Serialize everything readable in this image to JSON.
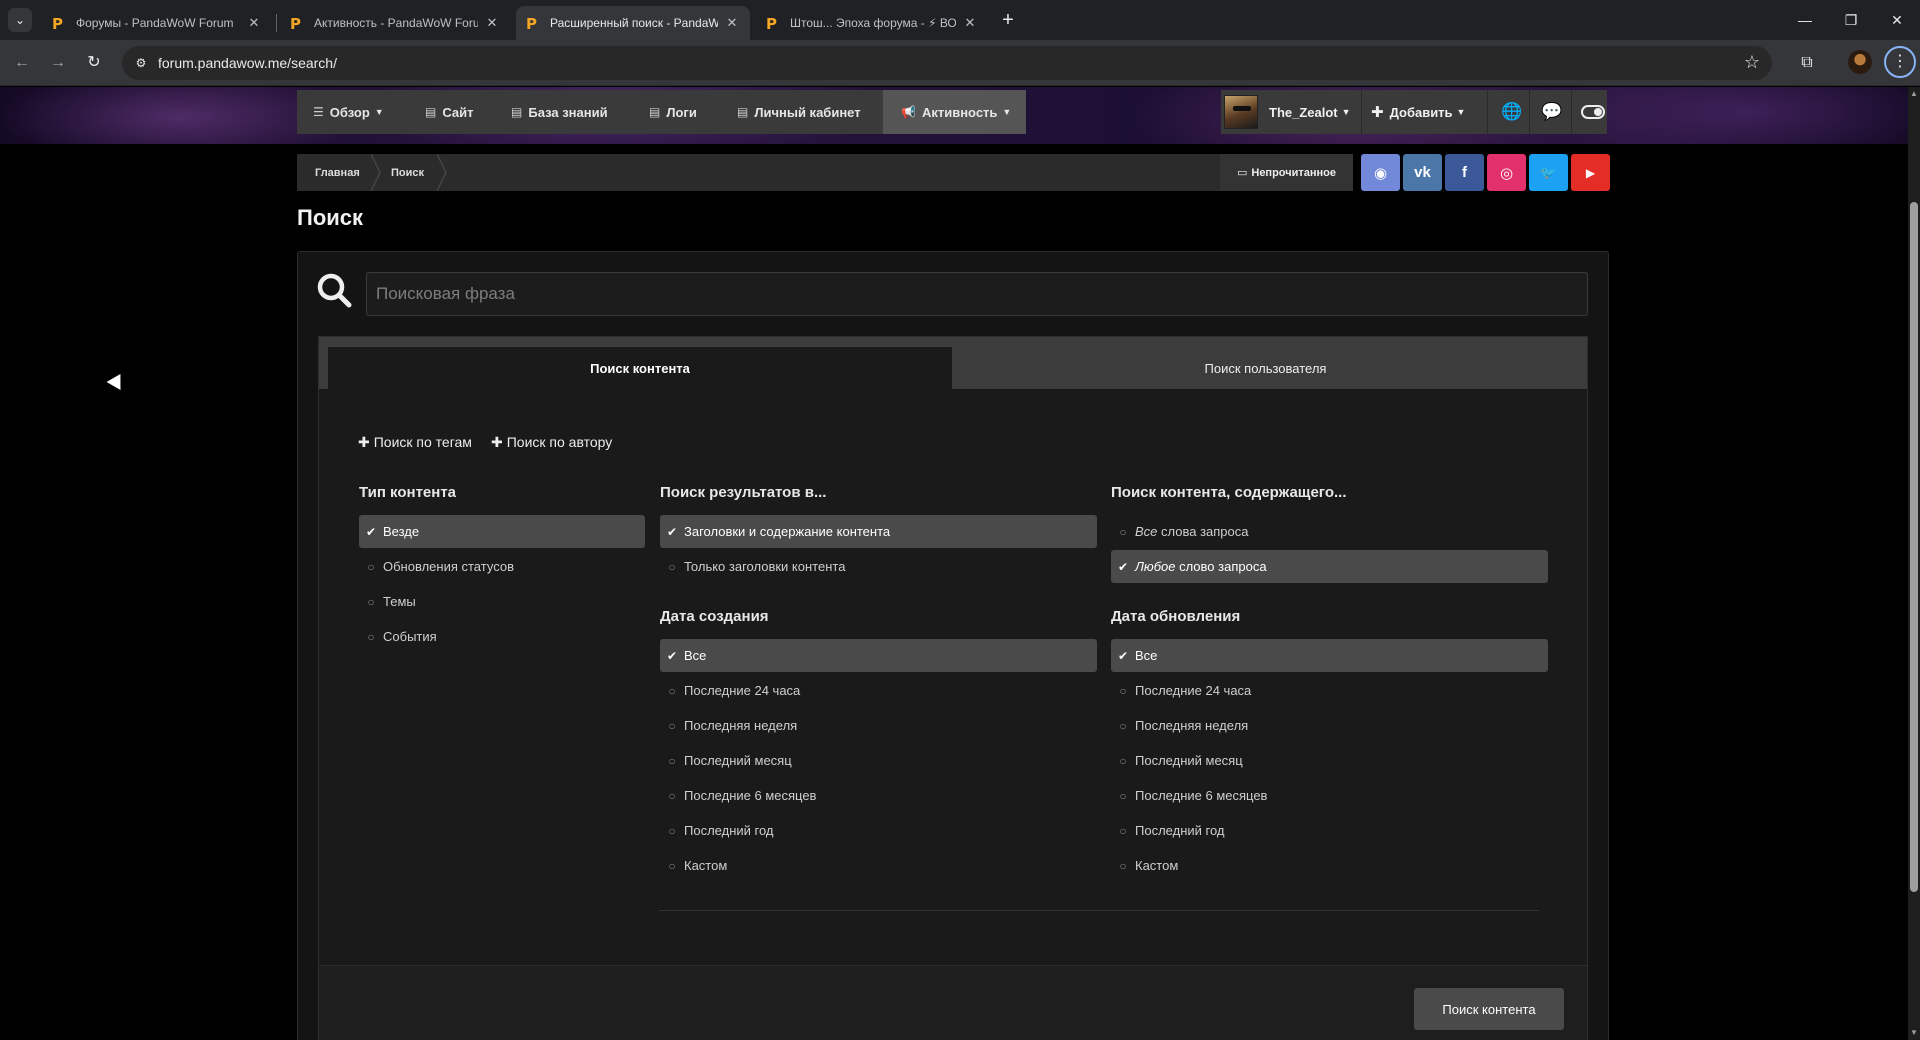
{
  "browser": {
    "tabs": [
      {
        "title": "Форумы - PandaWoW Forum",
        "active": false
      },
      {
        "title": "Активность - PandaWoW Forum",
        "active": false
      },
      {
        "title": "Расширенный поиск - PandaWoW",
        "active": true
      },
      {
        "title": "Штош... Эпоха форума - ⚡ ВО",
        "active": false
      }
    ],
    "url": "forum.pandawow.me/search/"
  },
  "nav": {
    "items": [
      {
        "label": "Обзор",
        "icon": "list-icon",
        "dropdown": true
      },
      {
        "label": "Сайт",
        "icon": "document-icon"
      },
      {
        "label": "База знаний",
        "icon": "document-icon"
      },
      {
        "label": "Логи",
        "icon": "document-icon"
      },
      {
        "label": "Личный кабинет",
        "icon": "document-icon"
      },
      {
        "label": "Активность",
        "icon": "megaphone-icon",
        "dropdown": true,
        "active": true
      }
    ],
    "username": "The_Zealot",
    "add_label": "Добавить"
  },
  "breadcrumb": [
    "Главная",
    "Поиск"
  ],
  "unread_label": "Непрочитанное",
  "social": [
    {
      "name": "discord",
      "color": "#7289da",
      "glyph": "◉"
    },
    {
      "name": "vk",
      "color": "#4a76a8",
      "glyph": "vk"
    },
    {
      "name": "facebook",
      "color": "#3b5998",
      "glyph": "f"
    },
    {
      "name": "instagram",
      "color": "#e1306c",
      "glyph": "◎"
    },
    {
      "name": "twitter",
      "color": "#1da1f2",
      "glyph": "🐦"
    },
    {
      "name": "youtube",
      "color": "#e52d27",
      "glyph": "▶"
    }
  ],
  "page_title": "Поиск",
  "search": {
    "placeholder": "Поисковая фраза",
    "value": ""
  },
  "tabs": [
    "Поиск контента",
    "Поиск пользователя"
  ],
  "filters": [
    "Поиск по тегам",
    "Поиск по автору"
  ],
  "content_type": {
    "title": "Тип контента",
    "options": [
      "Везде",
      "Обновления статусов",
      "Темы",
      "События"
    ],
    "selected": 0
  },
  "search_in": {
    "title": "Поиск результатов в...",
    "options": [
      "Заголовки и содержание контента",
      "Только заголовки контента"
    ],
    "selected": 0
  },
  "match": {
    "title": "Поиск контента, содержащего...",
    "options": [
      {
        "em": "Все",
        "rest": " слова запроса"
      },
      {
        "em": "Любое",
        "rest": " слово запроса"
      }
    ],
    "selected": 1
  },
  "created": {
    "title": "Дата создания",
    "options": [
      "Все",
      "Последние 24 часа",
      "Последняя неделя",
      "Последний месяц",
      "Последние 6 месяцев",
      "Последний год",
      "Кастом"
    ],
    "selected": 0
  },
  "updated": {
    "title": "Дата обновления",
    "options": [
      "Все",
      "Последние 24 часа",
      "Последняя неделя",
      "Последний месяц",
      "Последние 6 месяцев",
      "Последний год",
      "Кастом"
    ],
    "selected": 0
  },
  "submit_label": "Поиск контента"
}
